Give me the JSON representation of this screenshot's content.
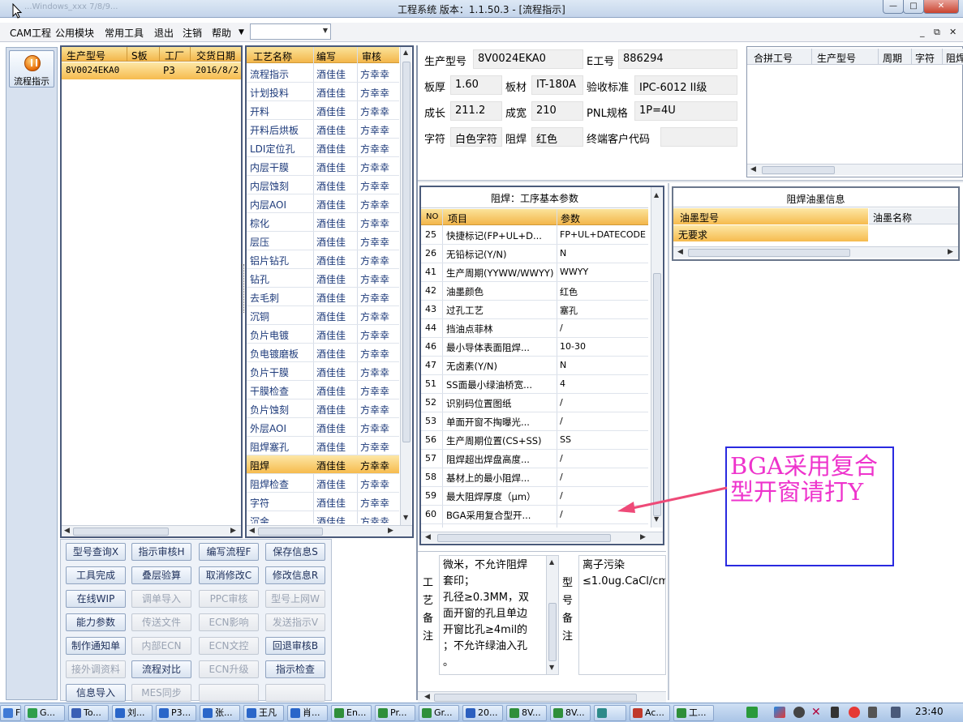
{
  "window": {
    "title": "工程系统   版本：1.1.50.3 - [流程指示]",
    "ghost_title": "...Windows_xxx 7/8/9...",
    "min": "—",
    "max": "□",
    "close": "✕"
  },
  "menu": {
    "items": [
      "CAM工程",
      "公用模块",
      "常用工具",
      "退出",
      "注销",
      "帮助"
    ],
    "combo_value": "",
    "mdi_min": "_",
    "mdi_restore": "⧉",
    "mdi_close": "✕"
  },
  "nav": {
    "flow_button": "流程指示"
  },
  "orders": {
    "headers": [
      "生产型号",
      "S板",
      "工厂",
      "交货日期"
    ],
    "rows": [
      {
        "model": "8V0024EKA0",
        "s": "",
        "factory": "P3",
        "date": "2016/8/2"
      }
    ]
  },
  "process": {
    "headers": [
      "工艺名称",
      "编写",
      "审核"
    ],
    "selected_index": 21,
    "rows": [
      {
        "name": "流程指示",
        "writer": "酒佳佳",
        "reviewer": "方幸幸"
      },
      {
        "name": "计划投料",
        "writer": "酒佳佳",
        "reviewer": "方幸幸"
      },
      {
        "name": "开料",
        "writer": "酒佳佳",
        "reviewer": "方幸幸"
      },
      {
        "name": "开料后烘板",
        "writer": "酒佳佳",
        "reviewer": "方幸幸"
      },
      {
        "name": "LDI定位孔",
        "writer": "酒佳佳",
        "reviewer": "方幸幸"
      },
      {
        "name": "内层干膜",
        "writer": "酒佳佳",
        "reviewer": "方幸幸"
      },
      {
        "name": "内层蚀刻",
        "writer": "酒佳佳",
        "reviewer": "方幸幸"
      },
      {
        "name": "内层AOI",
        "writer": "酒佳佳",
        "reviewer": "方幸幸"
      },
      {
        "name": "棕化",
        "writer": "酒佳佳",
        "reviewer": "方幸幸"
      },
      {
        "name": "层压",
        "writer": "酒佳佳",
        "reviewer": "方幸幸"
      },
      {
        "name": "铝片钻孔",
        "writer": "酒佳佳",
        "reviewer": "方幸幸"
      },
      {
        "name": "钻孔",
        "writer": "酒佳佳",
        "reviewer": "方幸幸"
      },
      {
        "name": "去毛刺",
        "writer": "酒佳佳",
        "reviewer": "方幸幸"
      },
      {
        "name": "沉铜",
        "writer": "酒佳佳",
        "reviewer": "方幸幸"
      },
      {
        "name": "负片电镀",
        "writer": "酒佳佳",
        "reviewer": "方幸幸"
      },
      {
        "name": "负电镀磨板",
        "writer": "酒佳佳",
        "reviewer": "方幸幸"
      },
      {
        "name": "负片干膜",
        "writer": "酒佳佳",
        "reviewer": "方幸幸"
      },
      {
        "name": "干膜检查",
        "writer": "酒佳佳",
        "reviewer": "方幸幸"
      },
      {
        "name": "负片蚀刻",
        "writer": "酒佳佳",
        "reviewer": "方幸幸"
      },
      {
        "name": "外层AOI",
        "writer": "酒佳佳",
        "reviewer": "方幸幸"
      },
      {
        "name": "阻焊塞孔",
        "writer": "酒佳佳",
        "reviewer": "方幸幸"
      },
      {
        "name": "阻焊",
        "writer": "酒佳佳",
        "reviewer": "方幸幸"
      },
      {
        "name": "阻焊检查",
        "writer": "酒佳佳",
        "reviewer": "方幸幸"
      },
      {
        "name": "字符",
        "writer": "酒佳佳",
        "reviewer": "方幸幸"
      },
      {
        "name": "沉金",
        "writer": "酒佳佳",
        "reviewer": "方幸幸"
      }
    ]
  },
  "info": {
    "model_label": "生产型号",
    "model": "8V0024EKA0",
    "eno_label": "E工号",
    "eno": "886294",
    "thick_label": "板厚",
    "thick": "1.60",
    "material_label": "板材",
    "material": "IT-180A",
    "standard_label": "验收标准",
    "standard": "IPC-6012 II级",
    "length_label": "成长",
    "length": "211.2",
    "width_label": "成宽",
    "width": "210",
    "pnl_label": "PNL规格",
    "pnl": "1P=4U",
    "char_label": "字符",
    "char": "白色字符",
    "mask_label": "阻焊",
    "mask": "红色",
    "customer_label": "终端客户代码",
    "customer": ""
  },
  "combine": {
    "headers": [
      "合拼工号",
      "生产型号",
      "周期",
      "字符",
      "阻焊"
    ]
  },
  "params": {
    "title": "阻焊：工序基本参数",
    "headers": [
      "NO",
      "项目",
      "参数"
    ],
    "rows": [
      {
        "no": "25",
        "item": "快捷标记(FP+UL+D...",
        "value": "FP+UL+DATECODE"
      },
      {
        "no": "26",
        "item": "无铅标记(Y/N)",
        "value": "N"
      },
      {
        "no": "41",
        "item": "生产周期(YYWW/WWYY)",
        "value": "WWYY"
      },
      {
        "no": "42",
        "item": "油墨颜色",
        "value": "红色"
      },
      {
        "no": "43",
        "item": "过孔工艺",
        "value": "塞孔"
      },
      {
        "no": "44",
        "item": "挡油点菲林",
        "value": "/"
      },
      {
        "no": "46",
        "item": "最小导体表面阻焊...",
        "value": "10-30"
      },
      {
        "no": "47",
        "item": "无卤素(Y/N)",
        "value": "N"
      },
      {
        "no": "51",
        "item": "SS面最小绿油桥宽...",
        "value": "4"
      },
      {
        "no": "52",
        "item": "识别码位置图纸",
        "value": "/"
      },
      {
        "no": "53",
        "item": "单面开窗不掏曝光...",
        "value": "/"
      },
      {
        "no": "56",
        "item": "生产周期位置(CS+SS)",
        "value": "SS"
      },
      {
        "no": "57",
        "item": "阻焊超出焊盘高度...",
        "value": "/"
      },
      {
        "no": "58",
        "item": "基材上的最小阻焊...",
        "value": "/"
      },
      {
        "no": "59",
        "item": "最大阻焊厚度（μm）",
        "value": "/"
      },
      {
        "no": "60",
        "item": "BGA采用复合型开...",
        "value": "/"
      }
    ]
  },
  "ink": {
    "title": "阻焊油墨信息",
    "headers": [
      "油墨型号",
      "油墨名称"
    ],
    "rows": [
      {
        "model": "无要求",
        "name": ""
      }
    ]
  },
  "annotation": "BGA采用复合\n型开窗请打Y",
  "buttons": [
    {
      "label": "型号查询X",
      "enabled": true
    },
    {
      "label": "指示审核H",
      "enabled": true
    },
    {
      "label": "编写流程F",
      "enabled": true
    },
    {
      "label": "保存信息S",
      "enabled": true
    },
    {
      "label": "工具完成",
      "enabled": true
    },
    {
      "label": "叠层验算",
      "enabled": true
    },
    {
      "label": "取消修改C",
      "enabled": true
    },
    {
      "label": "修改信息R",
      "enabled": true
    },
    {
      "label": "在线WIP",
      "enabled": true
    },
    {
      "label": "调单导入",
      "enabled": false
    },
    {
      "label": "PPC审核",
      "enabled": false
    },
    {
      "label": "型号上网W",
      "enabled": false
    },
    {
      "label": "能力参数",
      "enabled": true
    },
    {
      "label": "传送文件",
      "enabled": false
    },
    {
      "label": "ECN影响",
      "enabled": false
    },
    {
      "label": "发送指示V",
      "enabled": false
    },
    {
      "label": "制作通知单",
      "enabled": true
    },
    {
      "label": "内部ECN",
      "enabled": false
    },
    {
      "label": "ECN文控",
      "enabled": false
    },
    {
      "label": "回退审核B",
      "enabled": true
    },
    {
      "label": "接外调资料",
      "enabled": false
    },
    {
      "label": "流程对比",
      "enabled": true
    },
    {
      "label": "ECN升级",
      "enabled": false
    },
    {
      "label": "指示检查",
      "enabled": true
    },
    {
      "label": "信息导入",
      "enabled": true
    },
    {
      "label": "MES同步",
      "enabled": false
    },
    {
      "label": "",
      "enabled": false
    },
    {
      "label": "",
      "enabled": false
    }
  ],
  "remarks": {
    "craft_label": "工艺备注",
    "craft_lines": [
      "微米，不允许阻焊",
      "套印；",
      "孔径≥0.3MM，双",
      "面开窗的孔且单边",
      "开窗比孔≥4mil的",
      "；不允许绿油入孔",
      "。"
    ],
    "model_label": "型号备注",
    "model_lines": [
      "离子污染",
      "≤1.0ug.CaCl/cm"
    ]
  },
  "taskbar": {
    "tasks": [
      "Fo...",
      "G...",
      "To...",
      "刘...",
      "P3...",
      "张...",
      "王凡",
      "肖...",
      "En...",
      "Pr...",
      "Gr...",
      "20...",
      "8V...",
      "8V...",
      "",
      "Ac...",
      "工..."
    ],
    "clock": "23:40",
    "colors": {
      "accent": "#f3b64b",
      "selected": "#fde7a6",
      "link": "#1d3a7a",
      "annotation_text": "#ee33cc",
      "annotation_border": "#2a2ae0",
      "arrow": "#ee4a78"
    }
  }
}
